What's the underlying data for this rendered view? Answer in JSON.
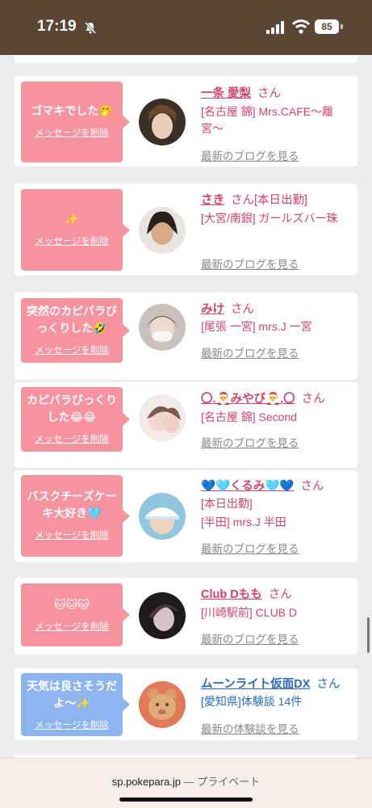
{
  "status_bar": {
    "time": "17:19",
    "battery": "85"
  },
  "cards": [
    {
      "message": "ゴマキでした🤭",
      "delete_label": "メッセージを削除",
      "name": "一条 愛梨",
      "san": "さん",
      "status": "",
      "lines": [
        "[名古屋 錦] Mrs.CAFE〜離宮〜"
      ],
      "link": "最新のブログを見る",
      "bubble": "pink"
    },
    {
      "message": "✨",
      "delete_label": "メッセージを削除",
      "name": "さき",
      "san": "さん",
      "status": "[本日出勤]",
      "lines": [
        "[大宮/南銀] ガールズバー珠"
      ],
      "link": "最新のブログを見る",
      "bubble": "pink"
    },
    {
      "message": "突然のカピバラびっくりした🤣",
      "delete_label": "メッセージを削除",
      "name": "みけ",
      "san": "さん",
      "status": "",
      "lines": [
        "[尾張 一宮] mrs.J 一宮"
      ],
      "link": "最新のブログを見る",
      "bubble": "pink"
    },
    {
      "message": "カピバラびっくりした😂😂",
      "delete_label": "メッセージを削除",
      "name": "〇.🎅みやび🎅.〇",
      "san": "さん",
      "status": "",
      "lines": [
        "[名古屋 錦] Second"
      ],
      "link": "最新のブログを見る",
      "bubble": "pink"
    },
    {
      "message": "バスクチーズケーキ大好き🩵",
      "delete_label": "メッセージを削除",
      "name": "💙🩵くるみ🩵💙",
      "san": "さん",
      "status": "",
      "lines": [
        "[本日出勤]",
        "[半田] mrs.J 半田"
      ],
      "link": "最新のブログを見る",
      "bubble": "pink"
    },
    {
      "message": "🐱🐱🐱",
      "delete_label": "メッセージを削除",
      "name": "Club Dもも",
      "san": "さん",
      "status": "",
      "lines": [
        "[川崎駅前] CLUB D"
      ],
      "link": "最新のブログを見る",
      "bubble": "pink"
    },
    {
      "message": "天気は良さそうだよ〜✨",
      "delete_label": "メッセージを削除",
      "name": "ムーンライト仮面DX",
      "san": "さん",
      "status": "",
      "lines": [
        "[愛知県]体験談 14件"
      ],
      "link": "最新の体験談を見る",
      "bubble": "blue"
    }
  ],
  "browser": {
    "domain": "sp.pokepara.jp",
    "separator": "—",
    "mode": "プライベート"
  }
}
